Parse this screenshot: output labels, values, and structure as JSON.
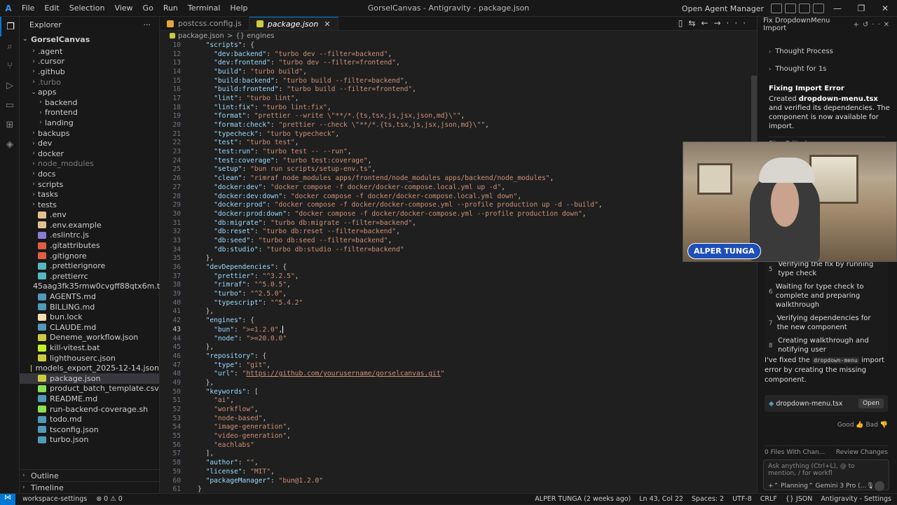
{
  "titlebar": {
    "menu": [
      "File",
      "Edit",
      "Selection",
      "View",
      "Go",
      "Run",
      "Terminal",
      "Help"
    ],
    "window_title": "GorselCanvas - Antigravity - package.json",
    "open_agent_manager": "Open Agent Manager",
    "controls": [
      "—",
      "❐",
      "✕"
    ]
  },
  "explorer": {
    "header": "Explorer",
    "root": "GorselCanvas",
    "items": [
      {
        "label": ".agent",
        "type": "folder",
        "depth": 1
      },
      {
        "label": ".cursor",
        "type": "folder",
        "depth": 1
      },
      {
        "label": ".github",
        "type": "folder",
        "depth": 1
      },
      {
        "label": ".turbo",
        "type": "folder",
        "depth": 1,
        "dim": true
      },
      {
        "label": "apps",
        "type": "folder-open",
        "depth": 1
      },
      {
        "label": "backend",
        "type": "folder",
        "depth": 2
      },
      {
        "label": "frontend",
        "type": "folder",
        "depth": 2
      },
      {
        "label": "landing",
        "type": "folder",
        "depth": 2
      },
      {
        "label": "backups",
        "type": "folder",
        "depth": 1
      },
      {
        "label": "dev",
        "type": "folder",
        "depth": 1
      },
      {
        "label": "docker",
        "type": "folder",
        "depth": 1
      },
      {
        "label": "node_modules",
        "type": "folder",
        "depth": 1,
        "dim": true
      },
      {
        "label": "docs",
        "type": "folder",
        "depth": 1
      },
      {
        "label": "scripts",
        "type": "folder",
        "depth": 1
      },
      {
        "label": "tasks",
        "type": "folder",
        "depth": 1
      },
      {
        "label": "tests",
        "type": "folder",
        "depth": 1
      },
      {
        "label": ".env",
        "type": "file",
        "depth": 1,
        "color": "#e2c08d"
      },
      {
        "label": ".env.example",
        "type": "file",
        "depth": 1,
        "color": "#e2c08d"
      },
      {
        "label": ".eslintrc.js",
        "type": "file",
        "depth": 1,
        "color": "#8b7cd6"
      },
      {
        "label": ".gitattributes",
        "type": "file",
        "depth": 1,
        "color": "#e05d44"
      },
      {
        "label": ".gitignore",
        "type": "file",
        "depth": 1,
        "color": "#e05d44"
      },
      {
        "label": ".prettierignore",
        "type": "file",
        "depth": 1,
        "color": "#56b6c2"
      },
      {
        "label": ".prettierrc",
        "type": "file",
        "depth": 1,
        "color": "#56b6c2"
      },
      {
        "label": "45aag3fk35rmw0cvgff88qtx6m.txt",
        "type": "file",
        "depth": 1,
        "color": "#aaaaaa"
      },
      {
        "label": "AGENTS.md",
        "type": "file",
        "depth": 1,
        "color": "#519aba"
      },
      {
        "label": "BILLING.md",
        "type": "file",
        "depth": 1,
        "color": "#519aba"
      },
      {
        "label": "bun.lock",
        "type": "file",
        "depth": 1,
        "color": "#f5deb3"
      },
      {
        "label": "CLAUDE.md",
        "type": "file",
        "depth": 1,
        "color": "#519aba"
      },
      {
        "label": "Deneme_workflow.json",
        "type": "file",
        "depth": 1,
        "color": "#cbcb41"
      },
      {
        "label": "kill-vitest.bat",
        "type": "file",
        "depth": 1,
        "color": "#c1f12e"
      },
      {
        "label": "lighthouserc.json",
        "type": "file",
        "depth": 1,
        "color": "#cbcb41"
      },
      {
        "label": "models_export_2025-12-14.json",
        "type": "file",
        "depth": 1,
        "color": "#cbcb41"
      },
      {
        "label": "package.json",
        "type": "file",
        "depth": 1,
        "color": "#cbcb41",
        "selected": true
      },
      {
        "label": "product_batch_template.csv",
        "type": "file",
        "depth": 1,
        "color": "#89e051"
      },
      {
        "label": "README.md",
        "type": "file",
        "depth": 1,
        "color": "#519aba"
      },
      {
        "label": "run-backend-coverage.sh",
        "type": "file",
        "depth": 1,
        "color": "#89e051"
      },
      {
        "label": "todo.md",
        "type": "file",
        "depth": 1,
        "color": "#519aba"
      },
      {
        "label": "tsconfig.json",
        "type": "file",
        "depth": 1,
        "color": "#519aba"
      },
      {
        "label": "turbo.json",
        "type": "file",
        "depth": 1,
        "color": "#519aba"
      }
    ],
    "outline": "Outline",
    "timeline": "Timeline"
  },
  "editor": {
    "tabs": [
      {
        "label": "postcss.config.js",
        "active": false
      },
      {
        "label": "package.json",
        "active": true
      }
    ],
    "breadcrumb": [
      "package.json",
      ">",
      "{} engines"
    ],
    "lines": [
      {
        "n": "10",
        "text": "  \"scripts\": {"
      },
      {
        "n": "12",
        "text": "    \"dev:backend\": \"turbo dev --filter=backend\","
      },
      {
        "n": "13",
        "text": "    \"dev:frontend\": \"turbo dev --filter=frontend\","
      },
      {
        "n": "14",
        "text": "    \"build\": \"turbo build\","
      },
      {
        "n": "15",
        "text": "    \"build:backend\": \"turbo build --filter=backend\","
      },
      {
        "n": "16",
        "text": "    \"build:frontend\": \"turbo build --filter=frontend\","
      },
      {
        "n": "17",
        "text": "    \"lint\": \"turbo lint\","
      },
      {
        "n": "18",
        "text": "    \"lint:fix\": \"turbo lint:fix\","
      },
      {
        "n": "19",
        "text": "    \"format\": \"prettier --write \\\"**/*.{ts,tsx,js,jsx,json,md}\\\"\","
      },
      {
        "n": "20",
        "text": "    \"format:check\": \"prettier --check \\\"**/*.{ts,tsx,js,jsx,json,md}\\\"\","
      },
      {
        "n": "21",
        "text": "    \"typecheck\": \"turbo typecheck\","
      },
      {
        "n": "22",
        "text": "    \"test\": \"turbo test\","
      },
      {
        "n": "23",
        "text": "    \"test:run\": \"turbo test -- --run\","
      },
      {
        "n": "24",
        "text": "    \"test:coverage\": \"turbo test:coverage\","
      },
      {
        "n": "25",
        "text": "    \"setup\": \"bun run scripts/setup-env.ts\","
      },
      {
        "n": "26",
        "text": "    \"clean\": \"rimraf node_modules apps/frontend/node_modules apps/backend/node_modules\","
      },
      {
        "n": "27",
        "text": "    \"docker:dev\": \"docker compose -f docker/docker-compose.local.yml up -d\","
      },
      {
        "n": "28",
        "text": "    \"docker:dev:down\": \"docker compose -f docker/docker-compose.local.yml down\","
      },
      {
        "n": "29",
        "text": "    \"docker:prod\": \"docker compose -f docker/docker-compose.yml --profile production up -d --build\","
      },
      {
        "n": "30",
        "text": "    \"docker:prod:down\": \"docker compose -f docker/docker-compose.yml --profile production down\","
      },
      {
        "n": "31",
        "text": "    \"db:migrate\": \"turbo db:migrate --filter=backend\","
      },
      {
        "n": "32",
        "text": "    \"db:reset\": \"turbo db:reset --filter=backend\","
      },
      {
        "n": "33",
        "text": "    \"db:seed\": \"turbo db:seed --filter=backend\","
      },
      {
        "n": "34",
        "text": "    \"db:studio\": \"turbo db:studio --filter=backend\""
      },
      {
        "n": "35",
        "text": "  },"
      },
      {
        "n": "36",
        "text": "  \"devDependencies\": {"
      },
      {
        "n": "37",
        "text": "    \"prettier\": \"^3.2.5\","
      },
      {
        "n": "38",
        "text": "    \"rimraf\": \"^5.0.5\","
      },
      {
        "n": "39",
        "text": "    \"turbo\": \"^2.5.0\","
      },
      {
        "n": "40",
        "text": "    \"typescript\": \"^5.4.2\""
      },
      {
        "n": "41",
        "text": "  },"
      },
      {
        "n": "42",
        "text": "  \"engines\": {"
      },
      {
        "n": "43",
        "text": "    \"bun\": \">=1.2.0\",",
        "cursor": true
      },
      {
        "n": "44",
        "text": "    \"node\": \">=20.0.0\""
      },
      {
        "n": "45",
        "text": "  },"
      },
      {
        "n": "46",
        "text": "  \"repository\": {"
      },
      {
        "n": "47",
        "text": "    \"type\": \"git\","
      },
      {
        "n": "48",
        "text": "    \"url\": \"https://github.com/yourusername/gorselcanvas.git\""
      },
      {
        "n": "49",
        "text": "  },"
      },
      {
        "n": "50",
        "text": "  \"keywords\": ["
      },
      {
        "n": "51",
        "text": "    \"ai\","
      },
      {
        "n": "52",
        "text": "    \"workflow\","
      },
      {
        "n": "53",
        "text": "    \"node-based\","
      },
      {
        "n": "54",
        "text": "    \"image-generation\","
      },
      {
        "n": "55",
        "text": "    \"video-generation\","
      },
      {
        "n": "56",
        "text": "    \"eachlabs\""
      },
      {
        "n": "57",
        "text": "  ],"
      },
      {
        "n": "58",
        "text": "  \"author\": \"\","
      },
      {
        "n": "59",
        "text": "  \"license\": \"MIT\","
      },
      {
        "n": "60",
        "text": "  \"packageManager\": \"bun@1.2.0\""
      },
      {
        "n": "61",
        "text": "}"
      }
    ]
  },
  "agent_panel": {
    "title": "Fix DropdownMenu Import",
    "thought_process": "Thought Process",
    "thought_for": "Thought for 1s",
    "card_title": "Fixing Import Error",
    "card_text_1": "Created",
    "card_file": "dropdown-menu.tsx",
    "card_text_2": "and verified its dependencies. The component is now available for import.",
    "files_edited": "Files Edited",
    "tasks": [
      {
        "n": "5",
        "text": "Verifying the fix by running type check"
      },
      {
        "n": "6",
        "text": "Waiting for type check to complete and preparing walkthrough"
      },
      {
        "n": "7",
        "text": "Verifying dependencies for the new component"
      },
      {
        "n": "8",
        "text": "Creating walkthrough and notifying user"
      }
    ],
    "summary_1": "I've fixed the",
    "summary_code": "dropdown-menu",
    "summary_2": "import error by creating the missing component.",
    "file_chip": "dropdown-menu.tsx",
    "open_label": "Open",
    "good": "Good",
    "bad": "Bad",
    "files_with_changes": "0 Files With Chan...",
    "review_changes": "Review Changes",
    "ask_placeholder": "Ask anything (Ctrl+L), @ to mention, / for workfl",
    "mode": "Planning",
    "model": "Gemini 3 Pro (..."
  },
  "webcam": {
    "name": "ALPER TUNGA"
  },
  "statusbar": {
    "branch": "workspace-settings",
    "errors": "⊗ 0 ⚠ 0",
    "author": "ALPER TUNGA (2 weeks ago)",
    "position": "Ln 43, Col 22",
    "spaces": "Spaces: 2",
    "encoding": "UTF-8",
    "eol": "CRLF",
    "language": "{} JSON",
    "settings": "Antigravity - Settings"
  }
}
